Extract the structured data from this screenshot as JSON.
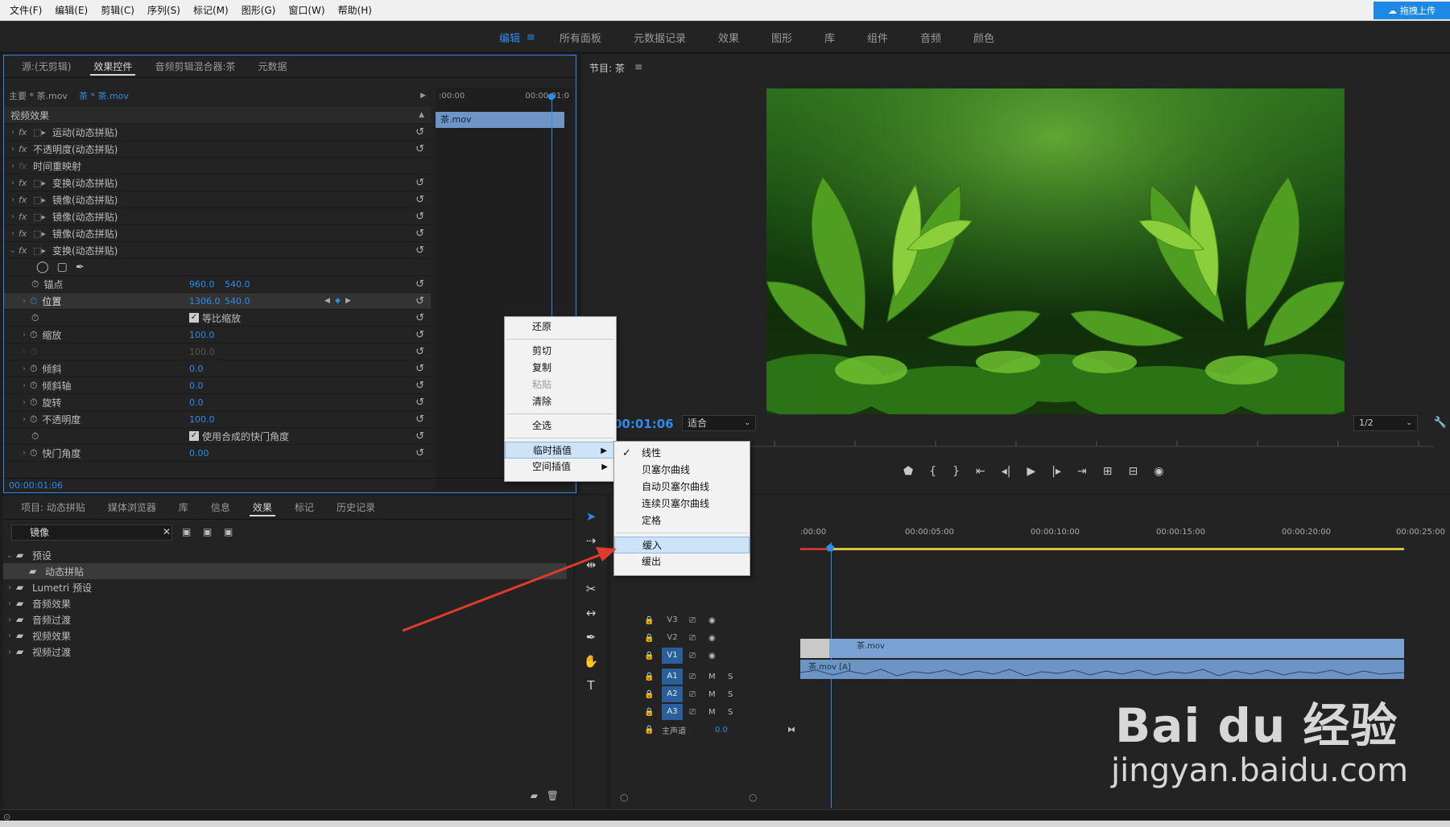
{
  "menubar": {
    "items": [
      "文件(F)",
      "编辑(E)",
      "剪辑(C)",
      "序列(S)",
      "标记(M)",
      "图形(G)",
      "窗口(W)",
      "帮助(H)"
    ],
    "cloud_button": "拖拽上传"
  },
  "workspaces": {
    "tabs": [
      "编辑",
      "所有面板",
      "元数据记录",
      "效果",
      "图形",
      "库",
      "组件",
      "音频",
      "颜色"
    ],
    "menu_icon": "≡"
  },
  "effect_controls": {
    "tabs": [
      "源:(无剪辑)",
      "效果控件",
      "音频剪辑混合器:茶",
      "元数据"
    ],
    "master_label": "主要 * 茶.mov",
    "clip_label": "茶 * 茶.mov",
    "ruler_start": ":00:00",
    "ruler_end": "00:00:01:0",
    "clip_bar": "茶.mov",
    "section": "视频效果",
    "rows": [
      {
        "label": "运动(动态拼贴)",
        "fx": "fx",
        "mask": true
      },
      {
        "label": "不透明度(动态拼贴)",
        "fx": "fx",
        "mask": false
      },
      {
        "label": "时间重映射",
        "fx": "fx",
        "mask": false
      },
      {
        "label": "变换(动态拼贴)",
        "fx": "fx",
        "mask": true
      },
      {
        "label": "镜像(动态拼贴)",
        "fx": "fx",
        "mask": true
      },
      {
        "label": "镜像(动态拼贴)",
        "fx": "fx",
        "mask": true
      },
      {
        "label": "镜像(动态拼贴)",
        "fx": "fx",
        "mask": true
      },
      {
        "label": "变换(动态拼贴)",
        "fx": "fx",
        "mask": true
      }
    ],
    "props": {
      "anchor": {
        "label": "锚点",
        "x": "960.0",
        "y": "540.0"
      },
      "position": {
        "label": "位置",
        "x": "1306.0",
        "y": "540.0"
      },
      "uniform_scale": "等比缩放",
      "scale": {
        "label": "缩放",
        "value": "100.0"
      },
      "scale_width": "100.0",
      "skew": {
        "label": "倾斜",
        "value": "0.0"
      },
      "skew_axis": {
        "label": "倾斜轴",
        "value": "0.0"
      },
      "rotation": {
        "label": "旋转",
        "value": "0.0"
      },
      "opacity": {
        "label": "不透明度",
        "value": "100.0"
      },
      "composite_shutter": "使用合成的快门角度",
      "shutter_angle": {
        "label": "快门角度",
        "value": "0.00"
      }
    },
    "timecode": "00:00:01:06"
  },
  "program": {
    "title": "节目: 茶",
    "timecode": "00:01:06",
    "fit": "适合",
    "resolution": "1/2"
  },
  "project": {
    "tabs": [
      "项目: 动态拼贴",
      "媒体浏览器",
      "库",
      "信息",
      "效果",
      "标记",
      "历史记录"
    ],
    "search_value": "镜像",
    "tree": [
      {
        "label": "预设",
        "indent": 0,
        "open": true,
        "sel": false
      },
      {
        "label": "动态拼贴",
        "indent": 1,
        "open": false,
        "sel": true
      },
      {
        "label": "Lumetri 预设",
        "indent": 0,
        "open": false,
        "sel": false
      },
      {
        "label": "音频效果",
        "indent": 0,
        "open": false,
        "sel": false
      },
      {
        "label": "音频过渡",
        "indent": 0,
        "open": false,
        "sel": false
      },
      {
        "label": "视频效果",
        "indent": 0,
        "open": false,
        "sel": false
      },
      {
        "label": "视频过渡",
        "indent": 0,
        "open": false,
        "sel": false
      }
    ]
  },
  "timeline": {
    "ticks": [
      ":00:00",
      "00:00:05:00",
      "00:00:10:00",
      "00:00:15:00",
      "00:00:20:00",
      "00:00:25:00"
    ],
    "tracks": [
      "V3",
      "V2",
      "V1",
      "A1",
      "A2",
      "A3"
    ],
    "master": "主声道",
    "master_value": "0.0",
    "video_clip": "茶.mov",
    "audio_clip": "茶.mov [A]"
  },
  "context_menu": {
    "items": [
      "还原",
      "剪切",
      "复制",
      "粘贴",
      "清除",
      "全选",
      "临时插值",
      "空间插值"
    ],
    "submenu": [
      "线性",
      "贝塞尔曲线",
      "自动贝塞尔曲线",
      "连续贝塞尔曲线",
      "定格",
      "缓入",
      "缓出"
    ]
  },
  "watermark": {
    "logo": "Bai du 经验",
    "url": "jingyan.baidu.com"
  },
  "colors": {
    "accent": "#2d8ceb",
    "panel": "#232323",
    "bg": "#1d1d1d"
  }
}
